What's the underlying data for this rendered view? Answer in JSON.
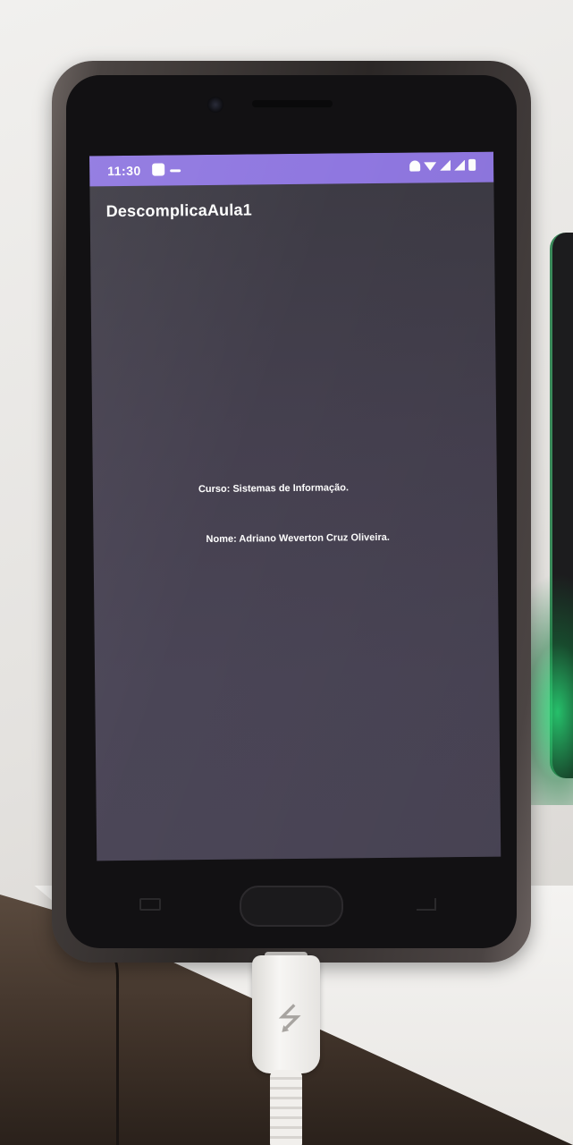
{
  "status_bar": {
    "time": "11:30"
  },
  "app": {
    "title": "DescomplicaAula1"
  },
  "content": {
    "course": "Curso: Sistemas de Informação.",
    "name": "Nome: Adriano Weverton Cruz Oliveira."
  },
  "colors": {
    "status_bar": "#8f77e0",
    "screen_background": "#45404f",
    "text": "#ffffff"
  }
}
